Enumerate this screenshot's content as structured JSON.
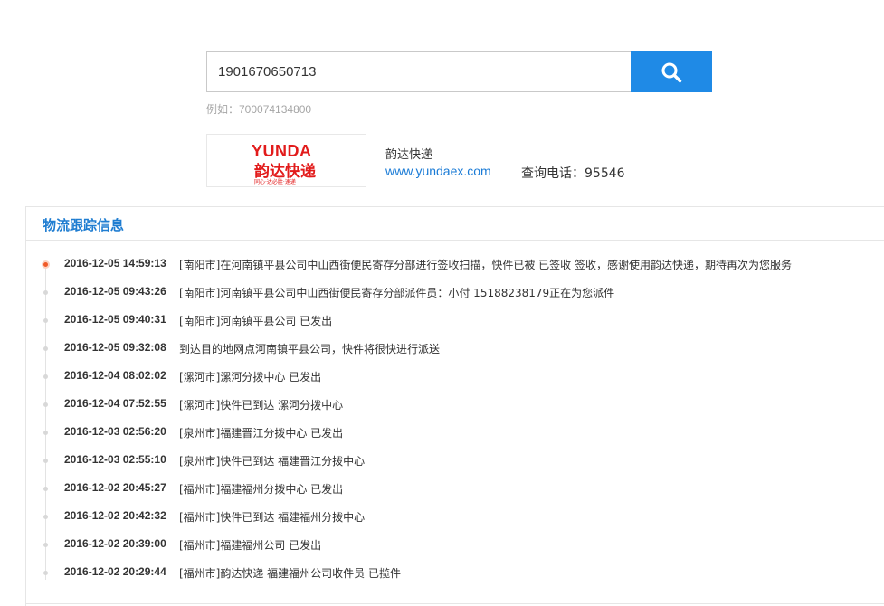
{
  "search": {
    "value": "1901670650713",
    "example": "例如：700074134800",
    "button_icon": "search-icon"
  },
  "company": {
    "logo_en": "YUNDA",
    "logo_cn": "韵达快递",
    "logo_slogan": "同心·达必胜·速递",
    "name": "韵达快递",
    "website": "www.yundaex.com",
    "phone": "查询电话：95546",
    "brand_color": "#e21b1b"
  },
  "tracking": {
    "title": "物流跟踪信息",
    "accent_color": "#1f8ae6",
    "active_dot_color": "#f05a28",
    "events": [
      {
        "time": "2016-12-05 14:59:13",
        "text": "[南阳市]在河南镇平县公司中山西街便民寄存分部进行签收扫描，快件已被 已签收 签收，感谢使用韵达快递，期待再次为您服务"
      },
      {
        "time": "2016-12-05 09:43:26",
        "text": "[南阳市]河南镇平县公司中山西街便民寄存分部派件员：小付 15188238179正在为您派件"
      },
      {
        "time": "2016-12-05 09:40:31",
        "text": "[南阳市]河南镇平县公司 已发出"
      },
      {
        "time": "2016-12-05 09:32:08",
        "text": "到达目的地网点河南镇平县公司，快件将很快进行派送"
      },
      {
        "time": "2016-12-04 08:02:02",
        "text": "[漯河市]漯河分拨中心 已发出"
      },
      {
        "time": "2016-12-04 07:52:55",
        "text": "[漯河市]快件已到达 漯河分拨中心"
      },
      {
        "time": "2016-12-03 02:56:20",
        "text": "[泉州市]福建晋江分拨中心 已发出"
      },
      {
        "time": "2016-12-03 02:55:10",
        "text": "[泉州市]快件已到达 福建晋江分拨中心"
      },
      {
        "time": "2016-12-02 20:45:27",
        "text": "[福州市]福建福州分拨中心 已发出"
      },
      {
        "time": "2016-12-02 20:42:32",
        "text": "[福州市]快件已到达 福建福州分拨中心"
      },
      {
        "time": "2016-12-02 20:39:00",
        "text": "[福州市]福建福州公司 已发出"
      },
      {
        "time": "2016-12-02 20:29:44",
        "text": "[福州市]韵达快递 福建福州公司收件员 已揽件"
      }
    ]
  }
}
